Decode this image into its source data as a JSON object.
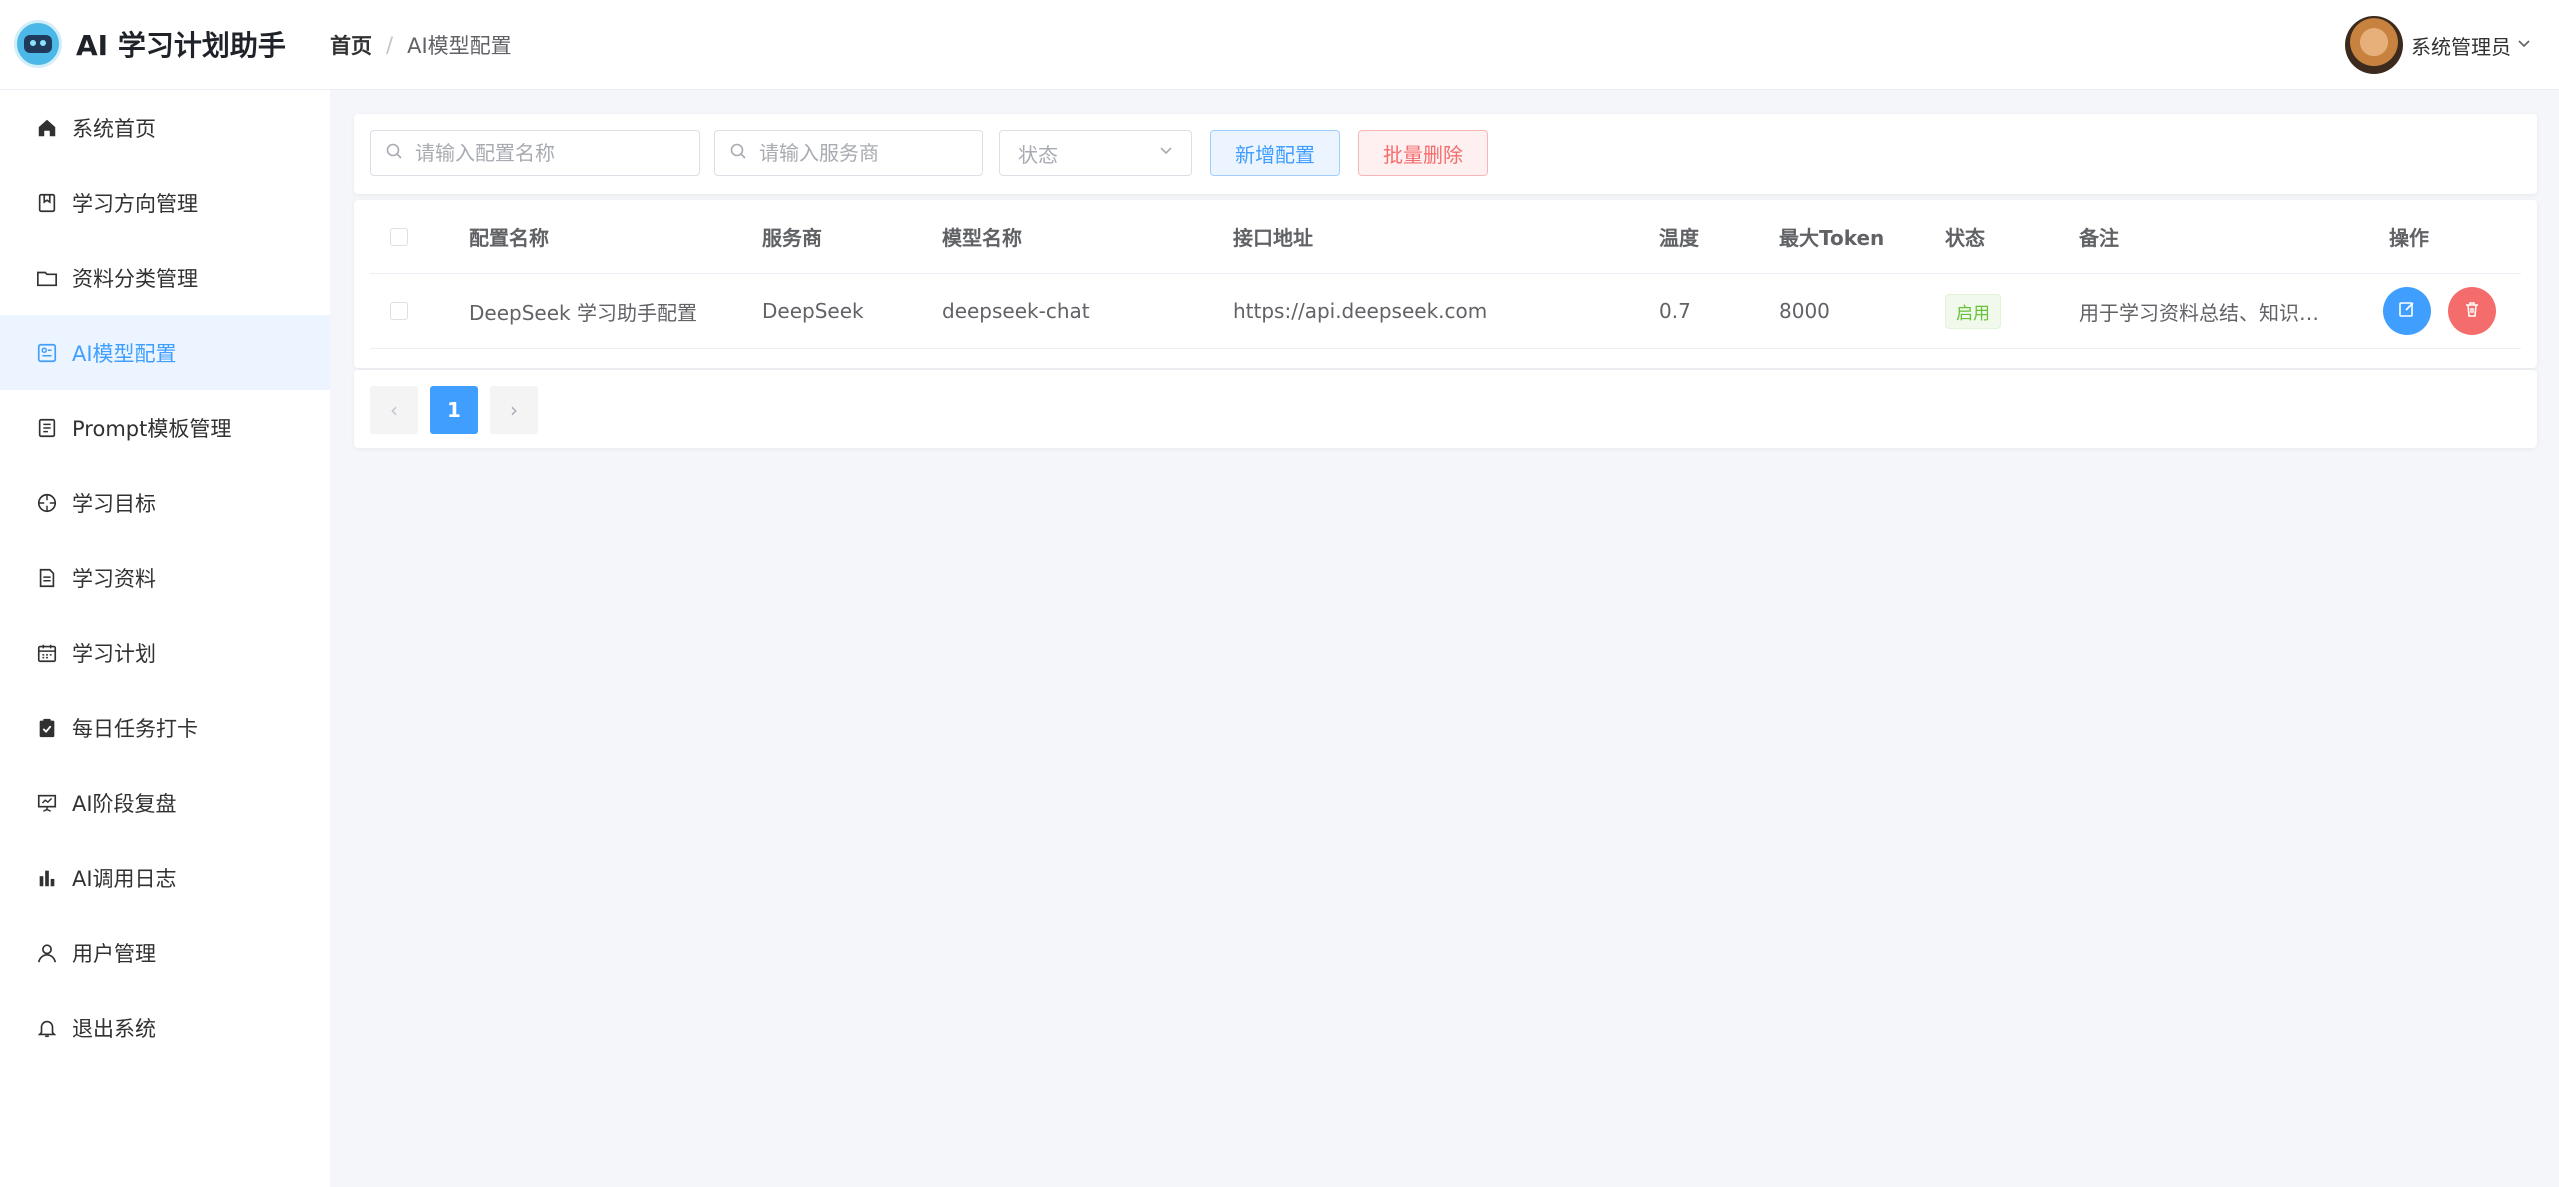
{
  "header": {
    "app_title": "AI 学习计划助手",
    "breadcrumb": {
      "home": "首页",
      "separator": "/",
      "current": "AI模型配置"
    },
    "user_name": "系统管理员"
  },
  "sidebar": {
    "items": [
      {
        "label": "系统首页",
        "icon": "home-icon"
      },
      {
        "label": "学习方向管理",
        "icon": "bookmark-icon"
      },
      {
        "label": "资料分类管理",
        "icon": "folder-icon"
      },
      {
        "label": "AI模型配置",
        "icon": "model-config-icon",
        "active": true
      },
      {
        "label": "Prompt模板管理",
        "icon": "document-icon"
      },
      {
        "label": "学习目标",
        "icon": "target-icon"
      },
      {
        "label": "学习资料",
        "icon": "file-icon"
      },
      {
        "label": "学习计划",
        "icon": "calendar-icon"
      },
      {
        "label": "每日任务打卡",
        "icon": "clipboard-check-icon"
      },
      {
        "label": "AI阶段复盘",
        "icon": "presentation-icon"
      },
      {
        "label": "AI调用日志",
        "icon": "bar-chart-icon"
      },
      {
        "label": "用户管理",
        "icon": "user-icon"
      },
      {
        "label": "退出系统",
        "icon": "bell-icon"
      }
    ]
  },
  "toolbar": {
    "config_name_placeholder": "请输入配置名称",
    "provider_placeholder": "请输入服务商",
    "status_placeholder": "状态",
    "add_label": "新增配置",
    "batch_delete_label": "批量删除"
  },
  "table": {
    "headers": {
      "name": "配置名称",
      "provider": "服务商",
      "model": "模型名称",
      "endpoint": "接口地址",
      "temperature": "温度",
      "max_token": "最大Token",
      "status": "状态",
      "remark": "备注",
      "actions": "操作"
    },
    "rows": [
      {
        "name": "DeepSeek 学习助手配置",
        "provider": "DeepSeek",
        "model": "deepseek-chat",
        "endpoint": "https://api.deepseek.com",
        "temperature": "0.7",
        "max_token": "8000",
        "status": "启用",
        "remark": "用于学习资料总结、知识…"
      }
    ]
  },
  "pagination": {
    "current_page": "1",
    "prev": "‹",
    "next": "›"
  },
  "colors": {
    "primary": "#409eff",
    "danger": "#f56c6c",
    "success": "#67c23a",
    "background": "#f4f6f9"
  }
}
